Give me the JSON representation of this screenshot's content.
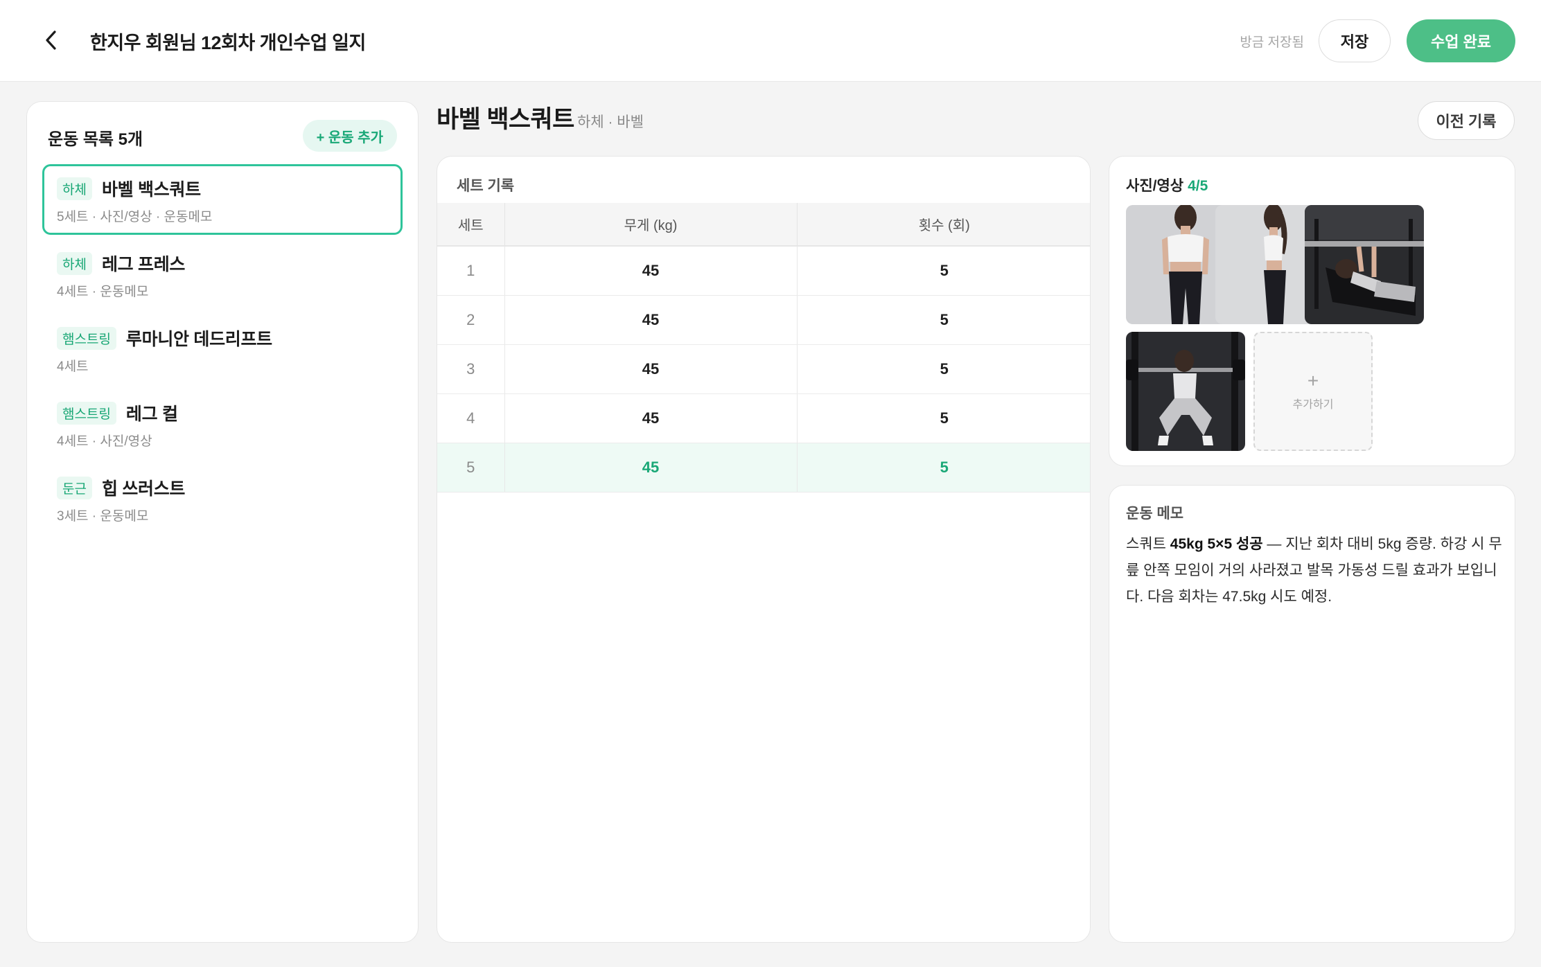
{
  "header": {
    "title": "한지우 회원님 12회차 개인수업 일지",
    "saved_status": "방금 저장됨",
    "save_label": "저장",
    "complete_label": "수업 완료",
    "accent_color": "#4dbf87"
  },
  "sidebar": {
    "title": "운동 목록 5개",
    "add_label": "+ 운동 추가",
    "items": [
      {
        "tag": "하체",
        "name": "바벨 백스쿼트",
        "sub": "5세트 · 사진/영상 · 운동메모",
        "active": true
      },
      {
        "tag": "하체",
        "name": "레그 프레스",
        "sub": "4세트 · 운동메모"
      },
      {
        "tag": "햄스트링",
        "name": "루마니안 데드리프트",
        "sub": "4세트"
      },
      {
        "tag": "햄스트링",
        "name": "레그 컬",
        "sub": "4세트 · 사진/영상"
      },
      {
        "tag": "둔근",
        "name": "힙 쓰러스트",
        "sub": "3세트 · 운동메모"
      }
    ]
  },
  "exercise": {
    "name": "바벨 백스쿼트",
    "meta": "하체 · 바벨",
    "history_label": "이전 기록"
  },
  "sets": {
    "title": "세트 기록",
    "columns": [
      "세트",
      "무게 (kg)",
      "횟수 (회)"
    ],
    "rows": [
      {
        "set": "1",
        "weight": "45",
        "reps": "5"
      },
      {
        "set": "2",
        "weight": "45",
        "reps": "5"
      },
      {
        "set": "3",
        "weight": "45",
        "reps": "5"
      },
      {
        "set": "4",
        "weight": "45",
        "reps": "5"
      },
      {
        "set": "5",
        "weight": "45",
        "reps": "5"
      }
    ]
  },
  "media": {
    "title": "사진/영상",
    "count": "4/5",
    "add_plus": "+",
    "add_label": "추가하기"
  },
  "memo": {
    "title": "운동 메모",
    "lead": "스쿼트 ",
    "bold": "45kg 5×5 성공",
    "rest": " — 지난 회차 대비 5kg 증량. 하강 시 무릎 안쪽 모임이 거의 사라졌고 발목 가동성 드릴 효과가 보입니다. 다음 회차는 47.5kg 시도 예정."
  }
}
